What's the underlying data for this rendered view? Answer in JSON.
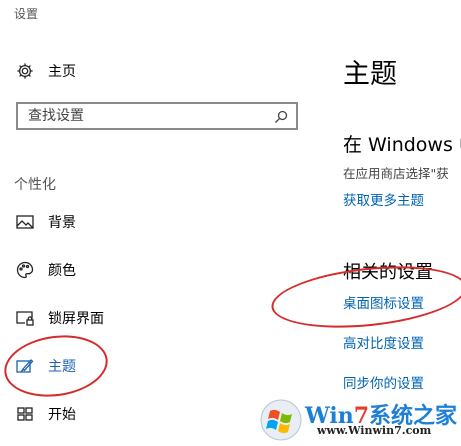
{
  "window": {
    "title": "设置"
  },
  "sidebar": {
    "home": {
      "label": "主页",
      "icon": "gear-icon"
    },
    "search": {
      "placeholder": "查找设置"
    },
    "section_heading": "个性化",
    "items": [
      {
        "label": "背景",
        "icon": "picture-icon"
      },
      {
        "label": "颜色",
        "icon": "palette-icon"
      },
      {
        "label": "锁屏界面",
        "icon": "lock-screen-icon"
      },
      {
        "label": "主题",
        "icon": "theme-brush-icon",
        "active": true
      },
      {
        "label": "开始",
        "icon": "start-grid-icon"
      }
    ]
  },
  "main": {
    "title": "主题",
    "windows_heading": "在 Windows 中",
    "windows_desc": "在应用商店选择\"获",
    "get_more_link": "获取更多主题",
    "related_heading": "相关的设置",
    "related_links": [
      "桌面图标设置",
      "高对比度设置",
      "同步你的设置"
    ]
  },
  "watermark": {
    "brand_prefix": "Wi",
    "brand_n": "n",
    "brand_seven": "7",
    "brand_suffix": "系统之家",
    "url": "www.Winwin7.com"
  },
  "colors": {
    "accent": "#0063b1",
    "annotation_red": "#d62b2b"
  }
}
